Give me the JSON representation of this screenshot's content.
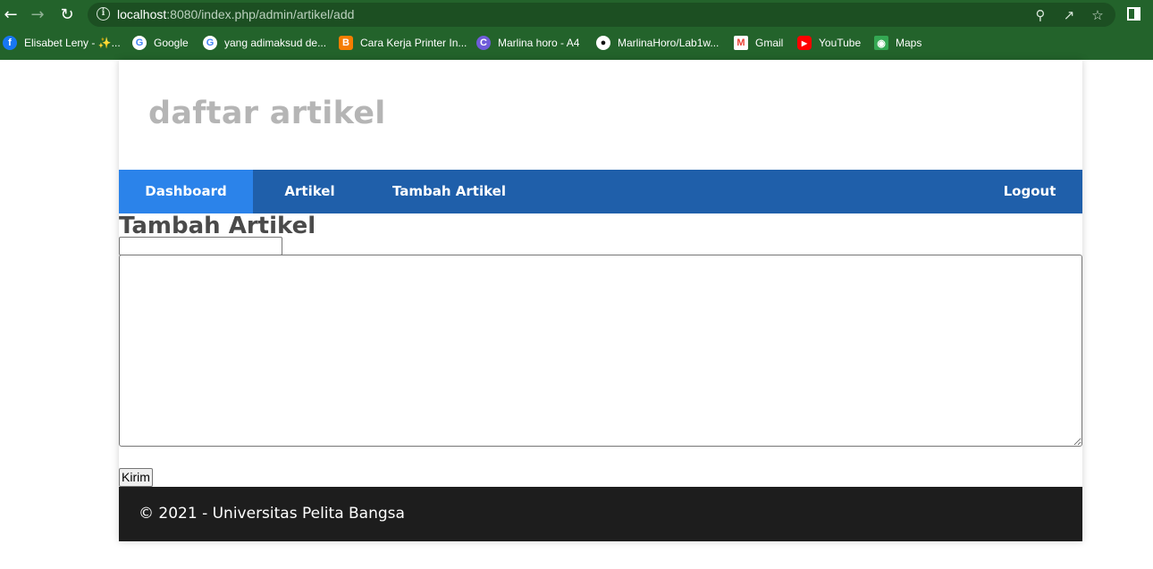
{
  "browser": {
    "url_host": "localhost",
    "url_rest": ":8080/index.php/admin/artikel/add",
    "bookmarks": [
      {
        "label": "Elisabet Leny - ✨...",
        "icon": "facebook-icon",
        "color": "#1877f2"
      },
      {
        "label": "Google",
        "icon": "google-icon",
        "color": "#ffffff"
      },
      {
        "label": "yang adimaksud de...",
        "icon": "google-icon",
        "color": "#ffffff"
      },
      {
        "label": "Cara Kerja Printer In...",
        "icon": "blogger-icon",
        "color": "#f57d00"
      },
      {
        "label": "Marlina horo - A4",
        "icon": "canva-icon",
        "color": "#6f5cd9"
      },
      {
        "label": "MarlinaHoro/Lab1w...",
        "icon": "github-icon",
        "color": "#ffffff"
      },
      {
        "label": "Gmail",
        "icon": "gmail-icon",
        "color": "#ffffff"
      },
      {
        "label": "YouTube",
        "icon": "youtube-icon",
        "color": "#ff0000"
      },
      {
        "label": "Maps",
        "icon": "maps-icon",
        "color": "#34a853"
      }
    ]
  },
  "site": {
    "title": "daftar artikel",
    "nav": {
      "dashboard": "Dashboard",
      "artikel": "Artikel",
      "tambah": "Tambah Artikel",
      "logout": "Logout"
    }
  },
  "form": {
    "heading": "Tambah Artikel",
    "title_value": "",
    "content_value": "",
    "submit_label": "Kirim"
  },
  "footer": {
    "text": "© 2021 - Universitas Pelita Bangsa"
  },
  "colors": {
    "chrome_bg": "#23632b",
    "navbar": "#1f5faa",
    "navbar_active": "#2b83ea",
    "footer": "#1d1d1d"
  }
}
